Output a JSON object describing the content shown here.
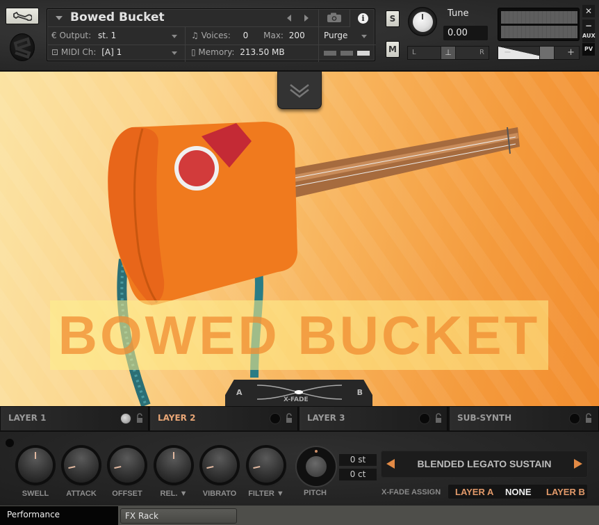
{
  "header": {
    "instrument_name": "Bowed Bucket",
    "output_label": "Output:",
    "output_value": "st. 1",
    "midi_label": "MIDI Ch:",
    "midi_value": "[A]  1",
    "voices_label": "Voices:",
    "voices_value": "0",
    "max_label": "Max:",
    "max_value": "200",
    "memory_label": "Memory:",
    "memory_value": "213.50 MB",
    "purge_label": "Purge",
    "solo_label": "S",
    "mute_label": "M",
    "tune_label": "Tune",
    "tune_value": "0.00",
    "pan_left": "L",
    "pan_right": "R",
    "vol_minus": "−",
    "vol_plus": "+",
    "side_buttons": [
      "✕",
      "−",
      "AUX",
      "PV"
    ]
  },
  "artwork": {
    "title": "BOWED BUCKET",
    "xfade_a": "A",
    "xfade_b": "B",
    "xfade_label": "X-FADE"
  },
  "layers": [
    {
      "label": "LAYER 1",
      "active": false,
      "enabled": true
    },
    {
      "label": "LAYER 2",
      "active": true,
      "enabled": false
    },
    {
      "label": "LAYER 3",
      "active": false,
      "enabled": false
    },
    {
      "label": "SUB-SYNTH",
      "active": false,
      "enabled": false
    }
  ],
  "controls": {
    "knobs": [
      {
        "label": "SWELL",
        "value": 0.5
      },
      {
        "label": "ATTACK",
        "value": 0.12
      },
      {
        "label": "OFFSET",
        "value": 0.12
      },
      {
        "label": "REL. ▼",
        "value": 0.5
      },
      {
        "label": "VIBRATO",
        "value": 0.12
      },
      {
        "label": "FILTER ▼",
        "value": 0.12
      }
    ],
    "pitch_label": "PITCH",
    "pitch_semitones": "0 st",
    "pitch_cents": "0 ct",
    "patch_name": "BLENDED LEGATO SUSTAIN",
    "xfade_assign_label": "X-FADE ASSIGN",
    "xfade_options": [
      "LAYER A",
      "NONE",
      "LAYER B"
    ],
    "xfade_selected": "NONE"
  },
  "bottom_tabs": {
    "performance": "Performance",
    "fx_rack": "FX Rack"
  },
  "colors": {
    "accent_orange": "#e28a45",
    "active_layer": "#e8a676"
  }
}
